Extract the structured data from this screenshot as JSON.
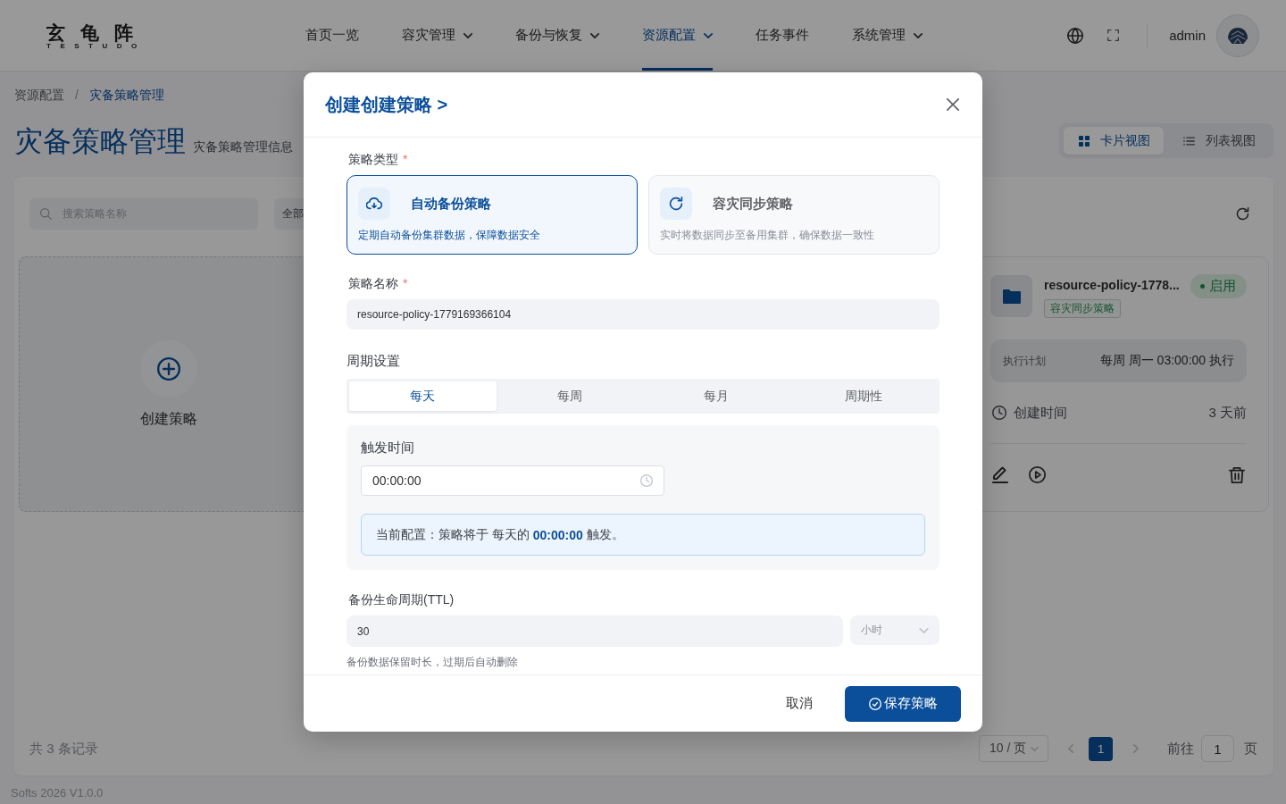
{
  "header": {
    "logo": {
      "title": "玄龟阵",
      "subtitle": "TESTUDO"
    },
    "nav": [
      {
        "label": "首页一览",
        "dropdown": false,
        "selected": false
      },
      {
        "label": "容灾管理",
        "dropdown": true,
        "selected": false
      },
      {
        "label": "备份与恢复",
        "dropdown": true,
        "selected": false
      },
      {
        "label": "资源配置",
        "dropdown": true,
        "selected": true
      },
      {
        "label": "任务事件",
        "dropdown": false,
        "selected": false
      },
      {
        "label": "系统管理",
        "dropdown": true,
        "selected": false
      }
    ],
    "user": {
      "name": "admin"
    }
  },
  "breadcrumb": {
    "separator": "/",
    "items": [
      {
        "label": "资源配置",
        "current": false
      },
      {
        "label": "灾备策略管理",
        "current": true
      }
    ]
  },
  "page": {
    "title": "灾备策略管理",
    "subtitle": "灾备策略管理信息"
  },
  "view_toggle": [
    {
      "kind": "grid",
      "label": "卡片视图",
      "selected": true
    },
    {
      "kind": "list",
      "label": "列表视图",
      "selected": false
    }
  ],
  "toolbar": {
    "search": {
      "placeholder": "搜索策略名称"
    },
    "filter": {
      "value": "全部"
    }
  },
  "create_card": {
    "label": "创建策略"
  },
  "policy_cards": [
    {
      "name": "resource-policy-1778...",
      "status": "启用",
      "enabled": true,
      "type": "容灾同步策略",
      "schedule_label": "执行计划",
      "schedule": "每周 周一 03:00:00 执行",
      "created_label": "创建时间",
      "created": "3 天前"
    }
  ],
  "pagination": {
    "total": "共 3 条记录",
    "page_size": "10 / 页",
    "pages": [
      {
        "label": "1",
        "selected": true
      }
    ],
    "goto_label": "前往",
    "goto_value": "1",
    "goto_suffix": "页"
  },
  "footer": {
    "text": "Softs 2026 V1.0.0"
  },
  "modal": {
    "title": "创建创建策略 >",
    "policy_type": {
      "label": "策略类型",
      "required_mark": "*",
      "options": [
        {
          "kind": "cloud",
          "title": "自动备份策略",
          "description": "定期自动备份集群数据，保障数据安全",
          "selected": true
        },
        {
          "kind": "sync",
          "title": "容灾同步策略",
          "description": "实时将数据同步至备用集群，确保数据一致性",
          "selected": false
        }
      ]
    },
    "policy_name": {
      "label": "策略名称",
      "required_mark": "*",
      "value": "resource-policy-1779169366104"
    },
    "schedule": {
      "label": "周期设置",
      "tabs": [
        {
          "label": "每天",
          "selected": true
        },
        {
          "label": "每周",
          "selected": false
        },
        {
          "label": "每月",
          "selected": false
        },
        {
          "label": "周期性",
          "selected": false
        }
      ],
      "trigger": {
        "label": "触发时间",
        "value": "00:00:00"
      },
      "summary": "当前配置：策略将于 每天的 **00:00:00** 触发。"
    },
    "ttl": {
      "label": "备份生命周期(TTL)",
      "value": "30",
      "unit": "小时",
      "hint": "备份数据保留时长，过期后自动删除"
    },
    "buttons": [
      {
        "kind": "text",
        "label": "取消"
      },
      {
        "kind": "primary",
        "label": "保存策略"
      }
    ]
  }
}
